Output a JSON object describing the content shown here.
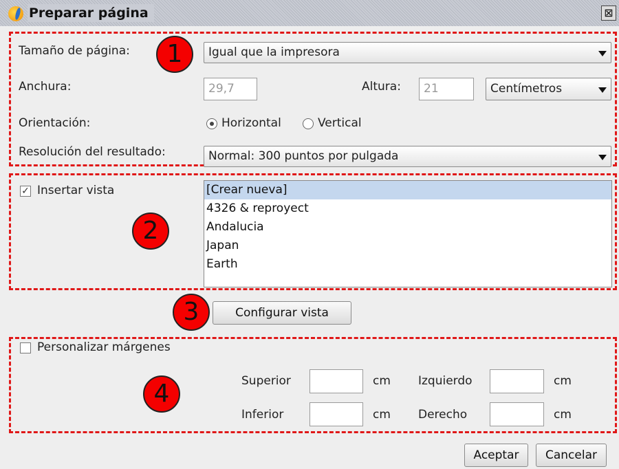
{
  "window": {
    "title": "Preparar página",
    "close_glyph": "⊠"
  },
  "annotations": {
    "badge1": "1",
    "badge2": "2",
    "badge3": "3",
    "badge4": "4",
    "color": "#e01818"
  },
  "page_size": {
    "label": "Tamaño de página:",
    "value": "Igual que la impresora"
  },
  "dimensions": {
    "width_label": "Anchura:",
    "width_value": "29,7",
    "height_label": "Altura:",
    "height_value": "21",
    "units_value": "Centímetros"
  },
  "orientation": {
    "label": "Orientación:",
    "options": [
      "Horizontal",
      "Vertical"
    ],
    "selected": "Horizontal"
  },
  "resolution": {
    "label": "Resolución del resultado:",
    "value": "Normal: 300 puntos por pulgada"
  },
  "insert_view": {
    "label": "Insertar vista",
    "checked": true,
    "check_glyph": "✓",
    "items": [
      "[Crear nueva]",
      "4326 & reproyect",
      "Andalucia",
      "Japan",
      "Earth"
    ],
    "selected_index": 0
  },
  "configure_button": "Configurar vista",
  "margins": {
    "label": "Personalizar márgenes",
    "checked": false,
    "superior": "Superior",
    "inferior": "Inferior",
    "izquierdo": "Izquierdo",
    "derecho": "Derecho",
    "unit": "cm"
  },
  "buttons": {
    "accept": "Aceptar",
    "cancel": "Cancelar"
  }
}
